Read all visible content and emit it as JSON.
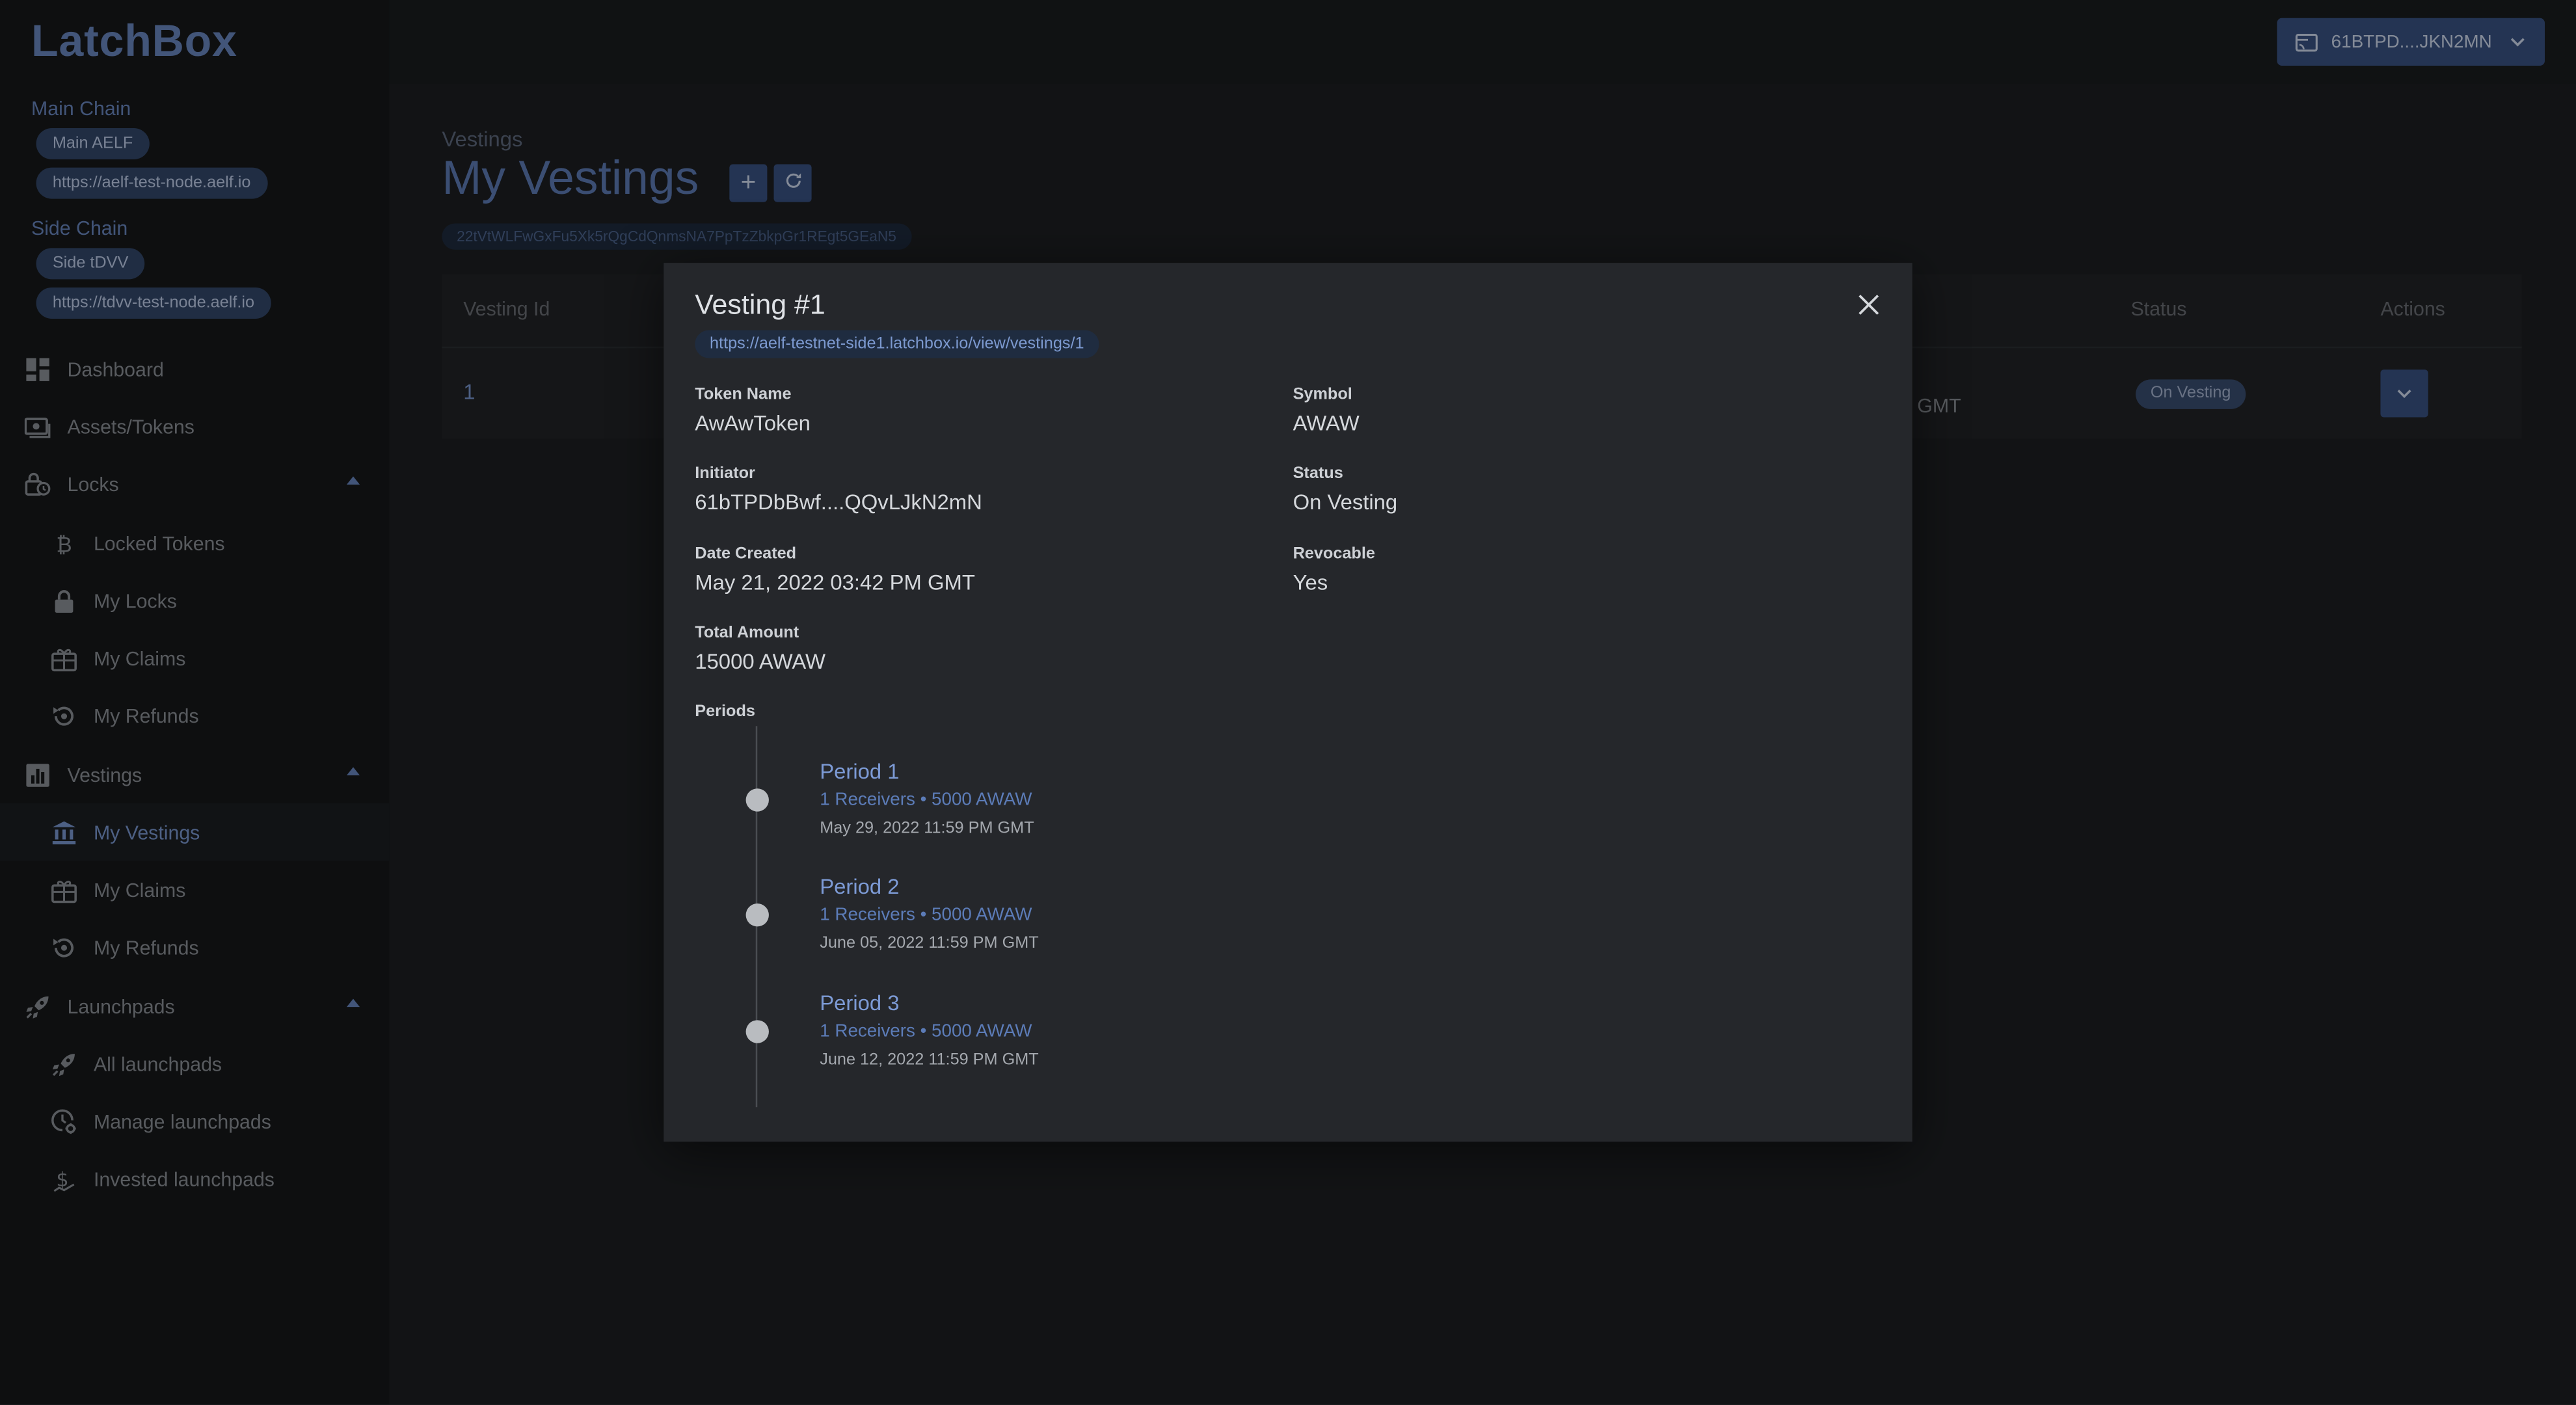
{
  "app": {
    "name": "LatchBox"
  },
  "sidebar": {
    "main_chain": {
      "label": "Main Chain",
      "name": "Main AELF",
      "url": "https://aelf-test-node.aelf.io"
    },
    "side_chain": {
      "label": "Side Chain",
      "name": "Side tDVV",
      "url": "https://tdvv-test-node.aelf.io"
    },
    "nav": {
      "dashboard": "Dashboard",
      "assets": "Assets/Tokens",
      "locks": "Locks",
      "locked_tokens": "Locked Tokens",
      "my_locks": "My Locks",
      "locks_my_claims": "My Claims",
      "locks_my_refunds": "My Refunds",
      "vestings": "Vestings",
      "my_vestings": "My Vestings",
      "vestings_my_claims": "My Claims",
      "vestings_my_refunds": "My Refunds",
      "launchpads": "Launchpads",
      "all_launchpads": "All launchpads",
      "manage_launchpads": "Manage launchpads",
      "invested_launchpads": "Invested launchpads"
    }
  },
  "topbar": {
    "wallet": "61BTPD....JKN2MN"
  },
  "page": {
    "breadcrumb": "Vestings",
    "title": "My Vestings",
    "address": "22tVtWLFwGxFu5Xk5rQgCdQnmsNA7PpTzZbkpGr1REgt5GEaN5"
  },
  "table": {
    "headers": {
      "vesting_id": "Vesting Id",
      "status": "Status",
      "actions": "Actions"
    },
    "row": {
      "id": "1",
      "date_fragment": "GMT",
      "status": "On Vesting"
    }
  },
  "modal": {
    "title": "Vesting #1",
    "link": "https://aelf-testnet-side1.latchbox.io/view/vestings/1",
    "fields": {
      "token_name_label": "Token Name",
      "token_name": "AwAwToken",
      "symbol_label": "Symbol",
      "symbol": "AWAW",
      "initiator_label": "Initiator",
      "initiator": "61bTPDbBwf....QQvLJkN2mN",
      "status_label": "Status",
      "status": "On Vesting",
      "date_created_label": "Date Created",
      "date_created": "May 21, 2022 03:42 PM GMT",
      "revocable_label": "Revocable",
      "revocable": "Yes",
      "total_amount_label": "Total Amount",
      "total_amount": "15000 AWAW"
    },
    "periods_label": "Periods",
    "periods": [
      {
        "title": "Period 1",
        "summary": "1 Receivers • 5000 AWAW",
        "date": "May 29, 2022 11:59 PM GMT"
      },
      {
        "title": "Period 2",
        "summary": "1 Receivers • 5000 AWAW",
        "date": "June 05, 2022 11:59 PM GMT"
      },
      {
        "title": "Period 3",
        "summary": "1 Receivers • 5000 AWAW",
        "date": "June 12, 2022 11:59 PM GMT"
      }
    ]
  },
  "colors": {
    "accent": "#3b5586",
    "link": "#7d9bd6",
    "background": "#1e2023",
    "sidebar": "#17191b",
    "modal": "#25272b"
  },
  "icons": {
    "dashboard": "dashboard-icon",
    "assets": "cash-icon",
    "locks": "lock-clock-icon",
    "locked_tokens": "bitcoin-icon",
    "my_locks": "padlock-icon",
    "claims": "gift-icon",
    "refunds": "refund-icon",
    "vestings": "bar-chart-icon",
    "my_vestings": "bank-icon",
    "launchpads": "rocket-icon",
    "manage_launchpads": "clock-cog-icon",
    "invested": "dollar-icon",
    "wallet": "wallet-icon",
    "close": "close-icon",
    "add": "plus-icon",
    "refresh": "refresh-icon"
  }
}
